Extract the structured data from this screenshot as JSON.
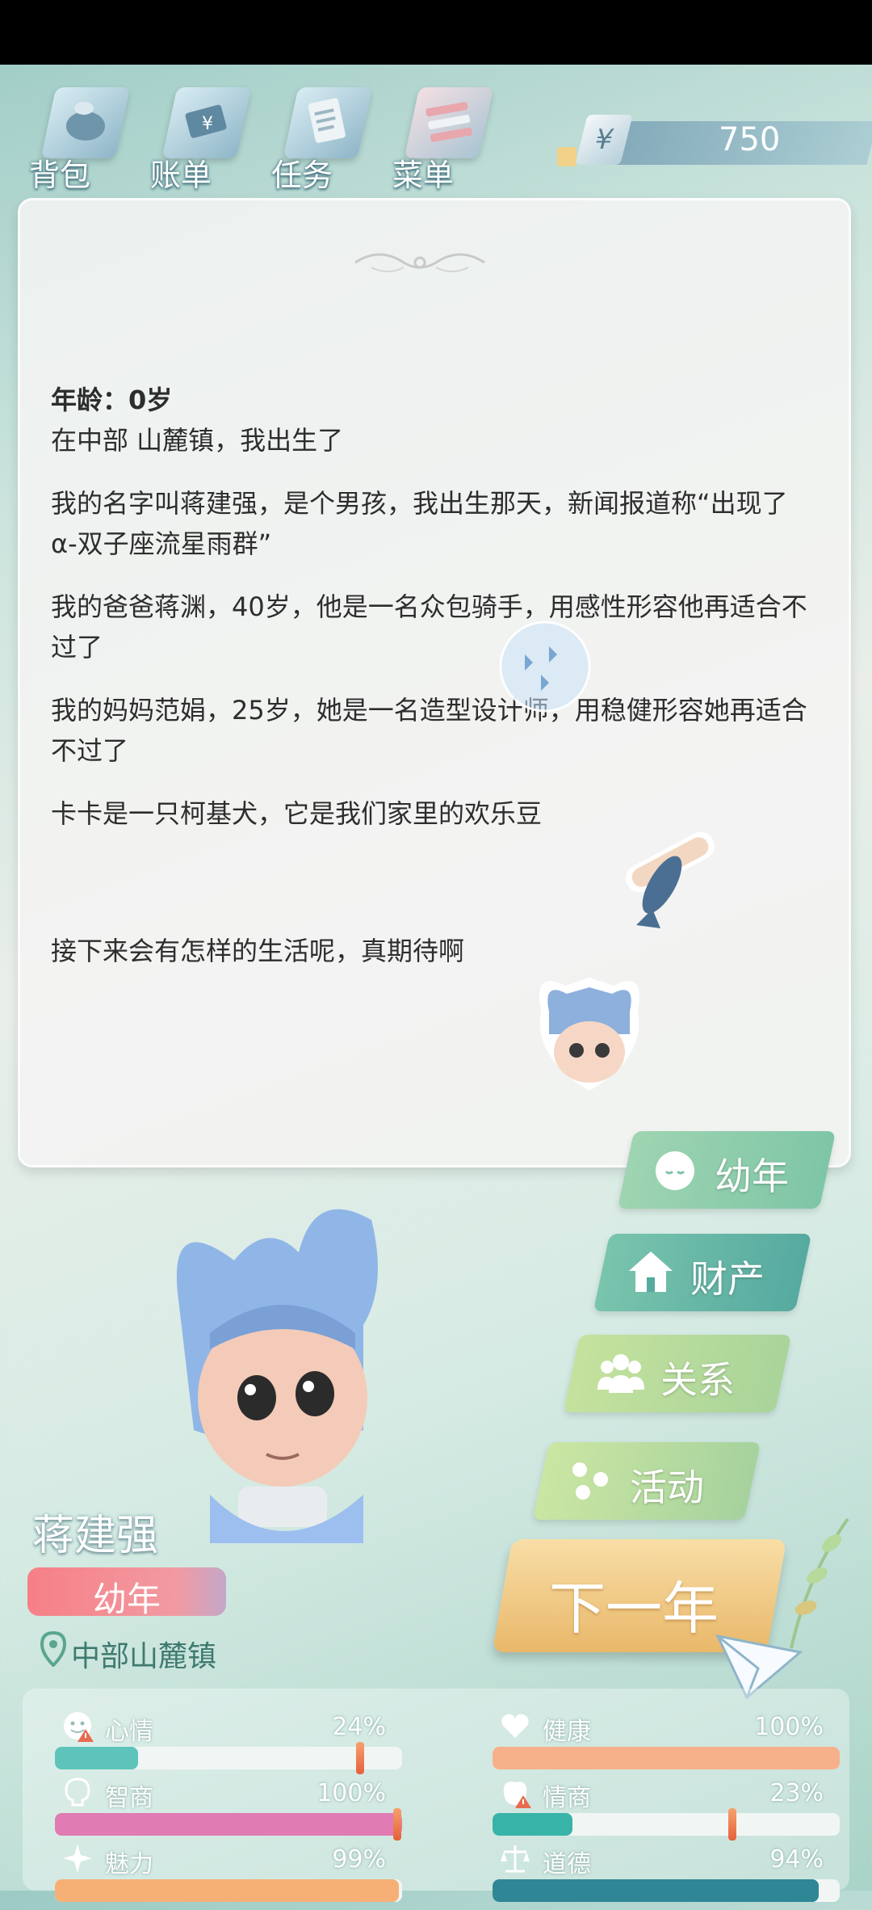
{
  "topbar": {
    "buttons": [
      {
        "label": "背包",
        "icon": "backpack-icon"
      },
      {
        "label": "账单",
        "icon": "bill-icon"
      },
      {
        "label": "任务",
        "icon": "task-icon"
      },
      {
        "label": "菜单",
        "icon": "menu-icon"
      }
    ],
    "currency_symbol": "¥",
    "money": "750"
  },
  "story": {
    "age_line": "年龄：0岁",
    "lines": [
      "在中部 山麓镇，我出生了",
      "我的名字叫蒋建强，是个男孩，我出生那天，新闻报道称“出现了α-双子座流星雨群”",
      "我的爸爸蒋渊，40岁，他是一名众包骑手，用感性形容他再适合不过了",
      "我的妈妈范娟，25岁，她是一名造型设计师，用稳健形容她再适合不过了",
      "卡卡是一只柯基犬，它是我们家里的欢乐豆",
      "接下来会有怎样的生活呢，真期待啊"
    ]
  },
  "actions": {
    "stage_button": "幼年",
    "property_button": "财产",
    "relations_button": "关系",
    "activity_button": "活动",
    "next_year_button": "下一年"
  },
  "character": {
    "name": "蒋建强",
    "stage": "幼年",
    "location": "中部山麓镇"
  },
  "stats": [
    {
      "label": "心情",
      "value": "24%",
      "fraction": 0.24,
      "color": "#5ec4bb",
      "icon": "mood-face-icon",
      "warning": true,
      "marker": 0.88
    },
    {
      "label": "健康",
      "value": "100%",
      "fraction": 1.0,
      "color": "#f6b08a",
      "icon": "heart-icon",
      "warning": false
    },
    {
      "label": "智商",
      "value": "100%",
      "fraction": 1.0,
      "color": "#e07bb3",
      "icon": "brain-icon",
      "warning": false,
      "marker": 0.985
    },
    {
      "label": "情商",
      "value": "23%",
      "fraction": 0.23,
      "color": "#38b3a8",
      "icon": "eq-icon",
      "warning": true,
      "marker": 0.69
    },
    {
      "label": "魅力",
      "value": "99%",
      "fraction": 0.99,
      "color": "#f6b076",
      "icon": "sparkle-icon",
      "warning": false
    },
    {
      "label": "道德",
      "value": "94%",
      "fraction": 0.94,
      "color": "#2f8796",
      "icon": "scale-icon",
      "warning": false
    }
  ]
}
